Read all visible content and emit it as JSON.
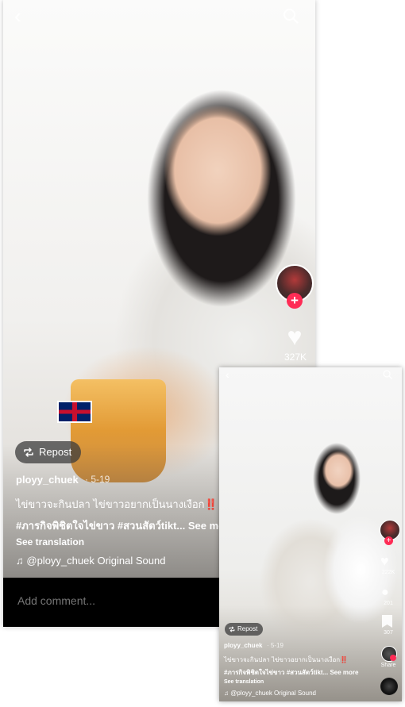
{
  "main": {
    "repost_label": "Repost",
    "username": "ployy_chuek",
    "date": "· 5-19",
    "caption_line1": "ไข่ขาวจะกินปลา ไข่ขาวอยากเป็นนางเงือก‼️",
    "caption_hashtags": "#ภารกิจพิชิตใจไข่ขาว #สวนสัตว์tikt...",
    "see_more": "See more",
    "see_translation": "See translation",
    "sound": "@ployy_chuek Original Sound",
    "likes": "327K",
    "comment_placeholder": "Add comment..."
  },
  "inset": {
    "repost_label": "Repost",
    "username": "ployy_chuek",
    "date": "· 5-19",
    "caption_line1": "ไข่ขาวจะกินปลา ไข่ขาวอยากเป็นนางเงือก‼️",
    "caption_hashtags": "#ภารกิจพิชิตใจไข่ขาว #สวนสัตว์tikt...",
    "see_more": "See more",
    "see_translation": "See translation",
    "sound": "@ployy_chuek Original Sound",
    "likes": "222K",
    "comments": "201",
    "saves": "307",
    "share_label": "Share"
  },
  "colors": {
    "accent": "#fe2c55",
    "comment_bar": "#000000"
  },
  "icons": [
    "back-icon",
    "search-icon",
    "plus-icon",
    "heart-icon",
    "comment-icon",
    "bookmark-icon",
    "repost-icon",
    "music-note-icon",
    "music-disc-icon"
  ]
}
